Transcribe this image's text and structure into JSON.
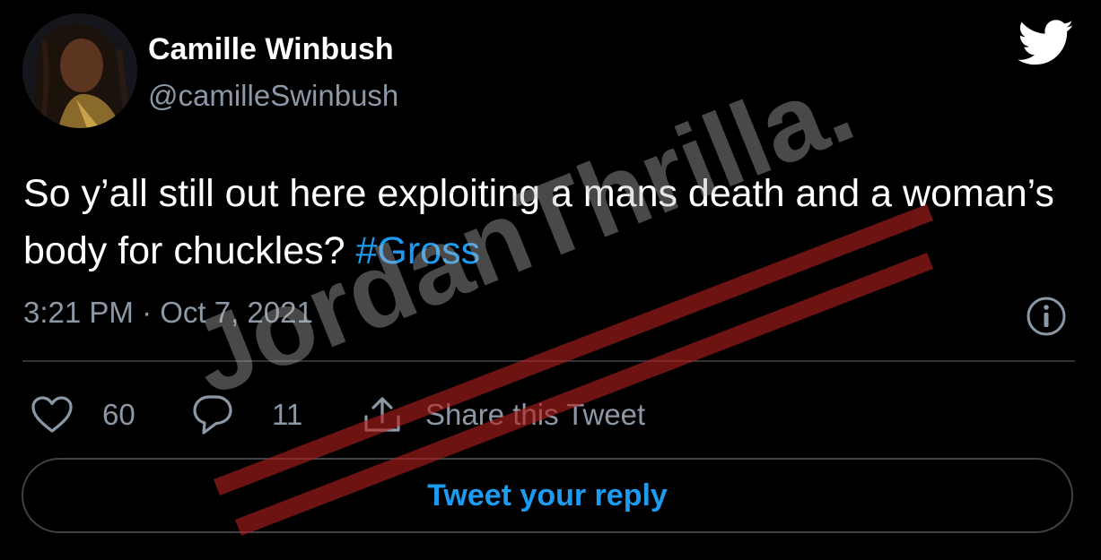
{
  "author": {
    "display_name": "Camille Winbush",
    "handle": "@camilleSwinbush"
  },
  "tweet": {
    "text": "So y’all still out here exploiting a mans death and a woman’s body for chuckles?",
    "hashtag": "#Gross",
    "timestamp": "3:21 PM · Oct 7, 2021"
  },
  "actions": {
    "likes": "60",
    "replies": "11",
    "share_label": "Share this Tweet"
  },
  "reply": {
    "label": "Tweet your reply"
  },
  "watermark": {
    "text": "JordanThrilla."
  },
  "icons": {
    "brand": "twitter-bird-icon",
    "info": "info-icon",
    "like": "heart-icon",
    "reply": "comment-icon",
    "share": "share-icon"
  },
  "colors": {
    "background": "#000000",
    "accent": "#1d9bf0",
    "secondary_text": "#8b98a5",
    "divider": "#2f3336",
    "watermark_stripe": "#b3201f"
  }
}
